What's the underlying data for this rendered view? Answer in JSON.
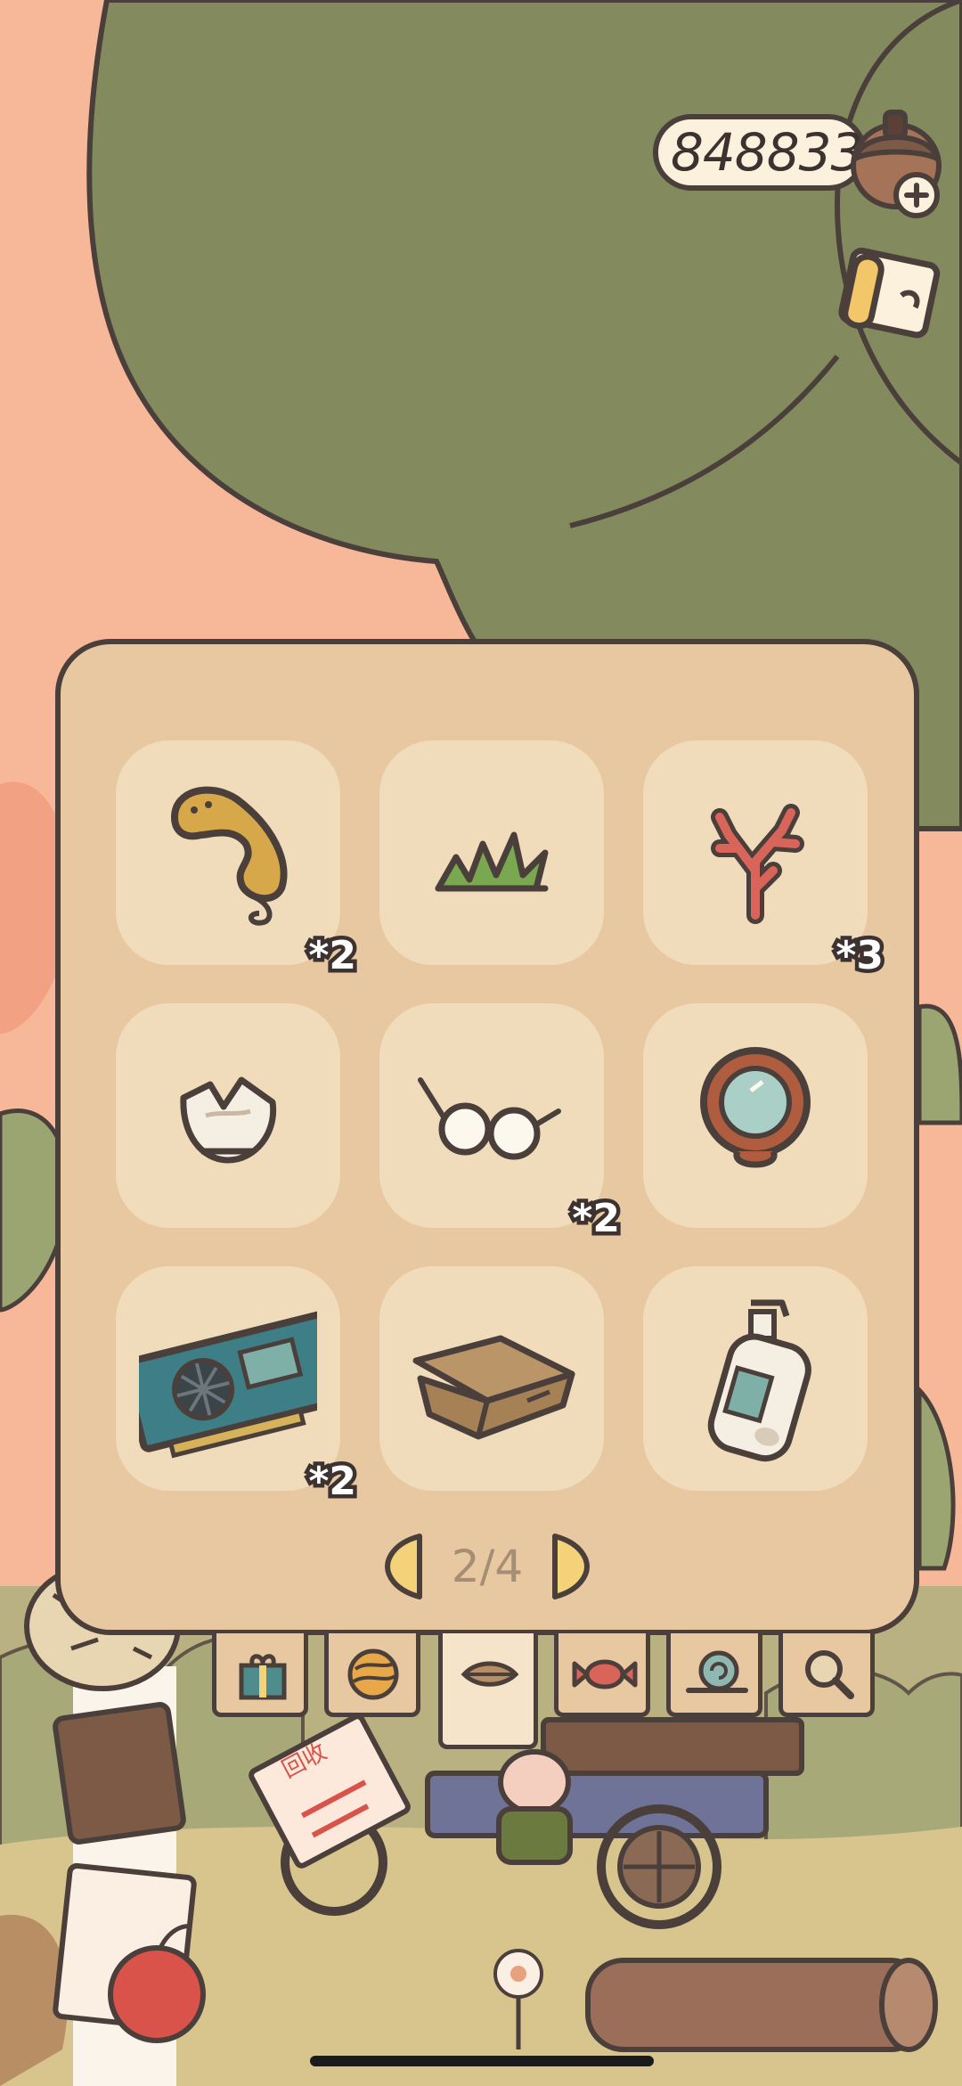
{
  "currency": {
    "value": "848833",
    "icon": "acorn-coin-icon",
    "add_icon": "plus-icon"
  },
  "side_button": {
    "icon": "scroll-map-icon"
  },
  "inventory": {
    "items": [
      {
        "name": "telephone-receiver",
        "icon": "telephone-receiver-icon",
        "count": "*2"
      },
      {
        "name": "grass-tuft",
        "icon": "grass-icon",
        "count": ""
      },
      {
        "name": "coral-branch",
        "icon": "coral-icon",
        "count": "*3"
      },
      {
        "name": "broken-bowl",
        "icon": "broken-bowl-icon",
        "count": ""
      },
      {
        "name": "glasses",
        "icon": "glasses-icon",
        "count": "*2"
      },
      {
        "name": "pocket-mirror",
        "icon": "mirror-icon",
        "count": ""
      },
      {
        "name": "graphics-card",
        "icon": "graphics-card-icon",
        "count": "*2"
      },
      {
        "name": "cardboard-box",
        "icon": "cardboard-box-icon",
        "count": ""
      },
      {
        "name": "soap-pump-bottle",
        "icon": "soap-bottle-icon",
        "count": ""
      }
    ],
    "page": "2/4"
  },
  "tabs": [
    {
      "icon": "gift-box-icon",
      "active": false
    },
    {
      "icon": "yarn-ball-icon",
      "active": false
    },
    {
      "icon": "leaf-icon",
      "active": true
    },
    {
      "icon": "candy-icon",
      "active": false
    },
    {
      "icon": "snail-icon",
      "active": false
    },
    {
      "icon": "magnifier-icon",
      "active": false
    }
  ],
  "scene": {
    "recycle_sign": "回收",
    "colors": {
      "background": "#f7b899",
      "tree": "#838b5e",
      "panel": "#e8c8a0",
      "slot": "#f0dcbb",
      "outline": "#4a3f3a"
    }
  }
}
